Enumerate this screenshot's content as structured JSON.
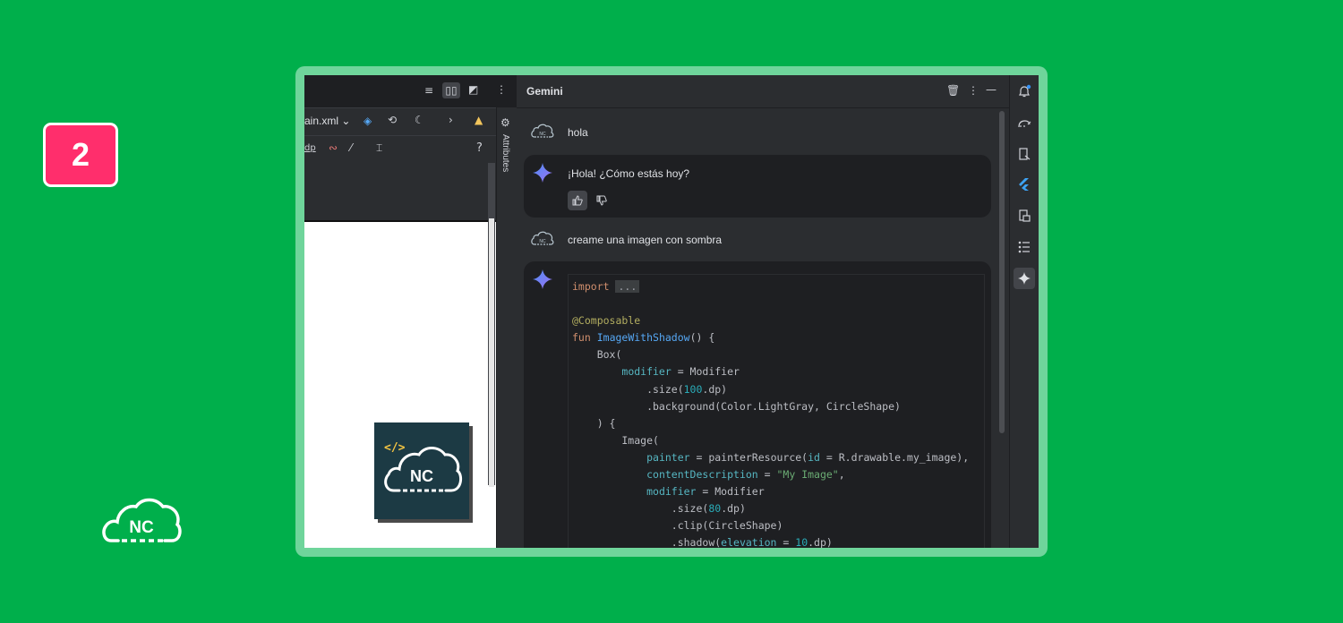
{
  "badge": {
    "number": "2"
  },
  "brand": {
    "logo_text": "NC"
  },
  "designer": {
    "file_name": "ain.xml",
    "dp_label": "dp",
    "help_label": "?",
    "attributes_label": "Attributes"
  },
  "gemini": {
    "title": "Gemini",
    "messages": [
      {
        "role": "user",
        "text": "hola"
      },
      {
        "role": "assistant",
        "text": "¡Hola! ¿Cómo estás hoy?"
      },
      {
        "role": "user",
        "text": "creame una imagen con sombra"
      }
    ],
    "code_lines": [
      "import ...",
      "",
      "@Composable",
      "fun ImageWithShadow() {",
      "    Box(",
      "        modifier = Modifier",
      "            .size(100.dp)",
      "            .background(Color.LightGray, CircleShape)",
      "    ) {",
      "        Image(",
      "            painter = painterResource(id = R.drawable.my_image),",
      "            contentDescription = \"My Image\",",
      "            modifier = Modifier",
      "                .size(80.dp)",
      "                .clip(CircleShape)",
      "                .shadow(elevation = 10.dp)"
    ]
  },
  "colors": {
    "background": "#00af4b",
    "badge": "#ff2e6c",
    "frame": "#6fd59b",
    "ide_bg": "#2b2d30"
  }
}
